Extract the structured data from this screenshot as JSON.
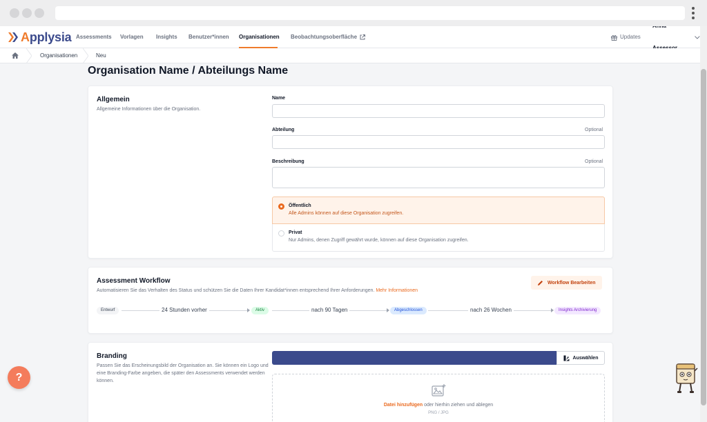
{
  "app": {
    "brand": {
      "prefix": "A",
      "rest": "pplysia",
      "accent": "#ef7b2b",
      "brand_color": "#3b4a8c"
    },
    "nav": {
      "items": [
        {
          "label": "Assessments"
        },
        {
          "label": "Vorlagen"
        },
        {
          "label": "Insights"
        },
        {
          "label": "Benutzer*innen"
        },
        {
          "label": "Organisationen",
          "active": true
        },
        {
          "label": "Beobachtungsoberfläche",
          "icon": "external-link-icon"
        }
      ],
      "updates": "Updates",
      "user": "Anna Assessor"
    },
    "breadcrumb": [
      "Organisationen",
      "Neu"
    ]
  },
  "page": {
    "title": "Organisation Name / Abteilungs Name",
    "general": {
      "title": "Allgemein",
      "description": "Allgemeine Informationen über die Organisation.",
      "name_label": "Name",
      "department_label": "Abteilung",
      "department_optional": "Optional",
      "description_label": "Beschreibung",
      "description_optional": "Optional",
      "visibility": {
        "public_title": "Öffentlich",
        "public_desc": "Alle Admins können auf diese Organisation zugreifen.",
        "private_title": "Privat",
        "private_desc": "Nur Admins, denen Zugriff gewährt wurde, können auf diese Organisation zugreifen.",
        "selected": "public"
      }
    },
    "workflow": {
      "title": "Assessment Workflow",
      "description": "Automatisieren Sie das Verhalten des Status und schützen Sie die Daten Ihrer Kandidat*innen entsprechend Ihrer Anforderungen.",
      "more_link": "Mehr Informationen",
      "edit_button": "Workflow Bearbeiten",
      "steps": [
        {
          "label": "Entwurf",
          "color": "#f3f4f6",
          "text_color": "#374151"
        },
        {
          "label": "Aktiv",
          "color": "#dcfce7",
          "text_color": "#15803d"
        },
        {
          "label": "Abgeschlossen",
          "color": "#dbeafe",
          "text_color": "#1d4ed8"
        },
        {
          "label": "Insights Archivierung",
          "color": "#f3e8ff",
          "text_color": "#7e22ce"
        }
      ],
      "transitions": [
        "24 Stunden vorher",
        "nach 90 Tagen",
        "nach 26 Wochen"
      ]
    },
    "branding": {
      "title": "Branding",
      "description": "Passen Sie das Erscheinungsbild der Organisation an. Sie können ein Logo und eine Branding-Farbe angeben, die später den Assessments verwendet werden können.",
      "brand_color": "#3b4a8c",
      "select_button": "Auswählen",
      "upload_link": "Datei hinzufügen",
      "upload_text": " oder hierhin ziehen und ablegen",
      "upload_hint": "PNG / JPG"
    }
  },
  "help": {
    "label": "?"
  }
}
